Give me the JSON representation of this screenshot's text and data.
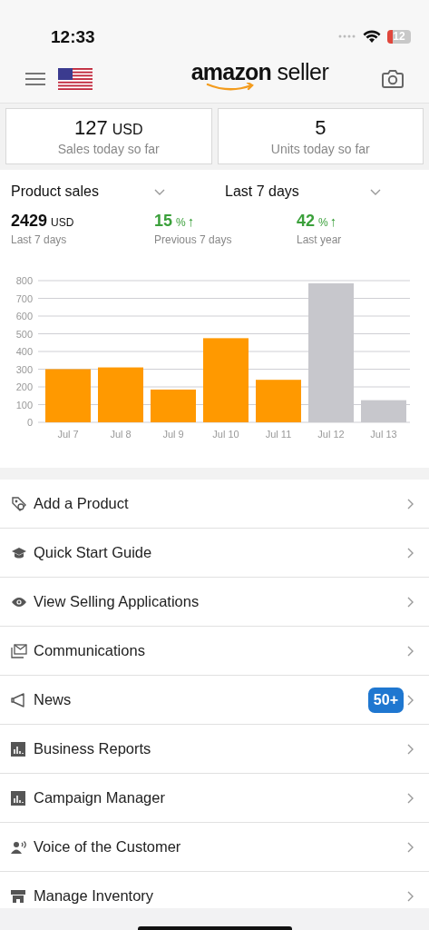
{
  "status_bar": {
    "time": "12:33",
    "battery": "12"
  },
  "header": {
    "logo": "**amazon** seller"
  },
  "today": [
    {
      "value": "127",
      "unit": "USD",
      "label": "Sales today so far"
    },
    {
      "value": "5",
      "label": "Units today so far"
    }
  ],
  "filters": [
    {
      "label": "Product sales"
    },
    {
      "label": "Last 7 days"
    }
  ],
  "totals": [
    {
      "kind": "total",
      "value": "2429",
      "unit": "USD",
      "label": "Last 7 days"
    },
    {
      "kind": "change",
      "value": "15",
      "unit": "%",
      "arrow": "↑",
      "label": "Previous 7 days"
    },
    {
      "kind": "change",
      "value": "42",
      "unit": "%",
      "arrow": "↑",
      "label": "Last year"
    }
  ],
  "chart_data": {
    "type": "bar",
    "categories": [
      "Jul 7",
      "Jul 8",
      "Jul 9",
      "Jul 10",
      "Jul 11",
      "Jul 12",
      "Jul 13"
    ],
    "grid": true,
    "ylim": [
      0,
      800
    ],
    "yticks": [
      0,
      100,
      200,
      300,
      400,
      500,
      600,
      700,
      800
    ],
    "series": [
      {
        "color": "#ff9900",
        "values": [
          300,
          310,
          185,
          475,
          240,
          null,
          null
        ]
      },
      {
        "color": "#c7c7cc",
        "values": [
          null,
          null,
          null,
          null,
          null,
          785,
          125
        ]
      }
    ]
  },
  "menu": [
    {
      "label": "Add a Product"
    },
    {
      "label": "Quick Start Guide"
    },
    {
      "label": "View Selling Applications"
    },
    {
      "label": "Communications"
    },
    {
      "label": "News",
      "badge": "50+"
    },
    {
      "label": "Business Reports"
    },
    {
      "label": "Campaign Manager"
    },
    {
      "label": "Voice of the Customer"
    },
    {
      "label": "Manage Inventory"
    }
  ]
}
